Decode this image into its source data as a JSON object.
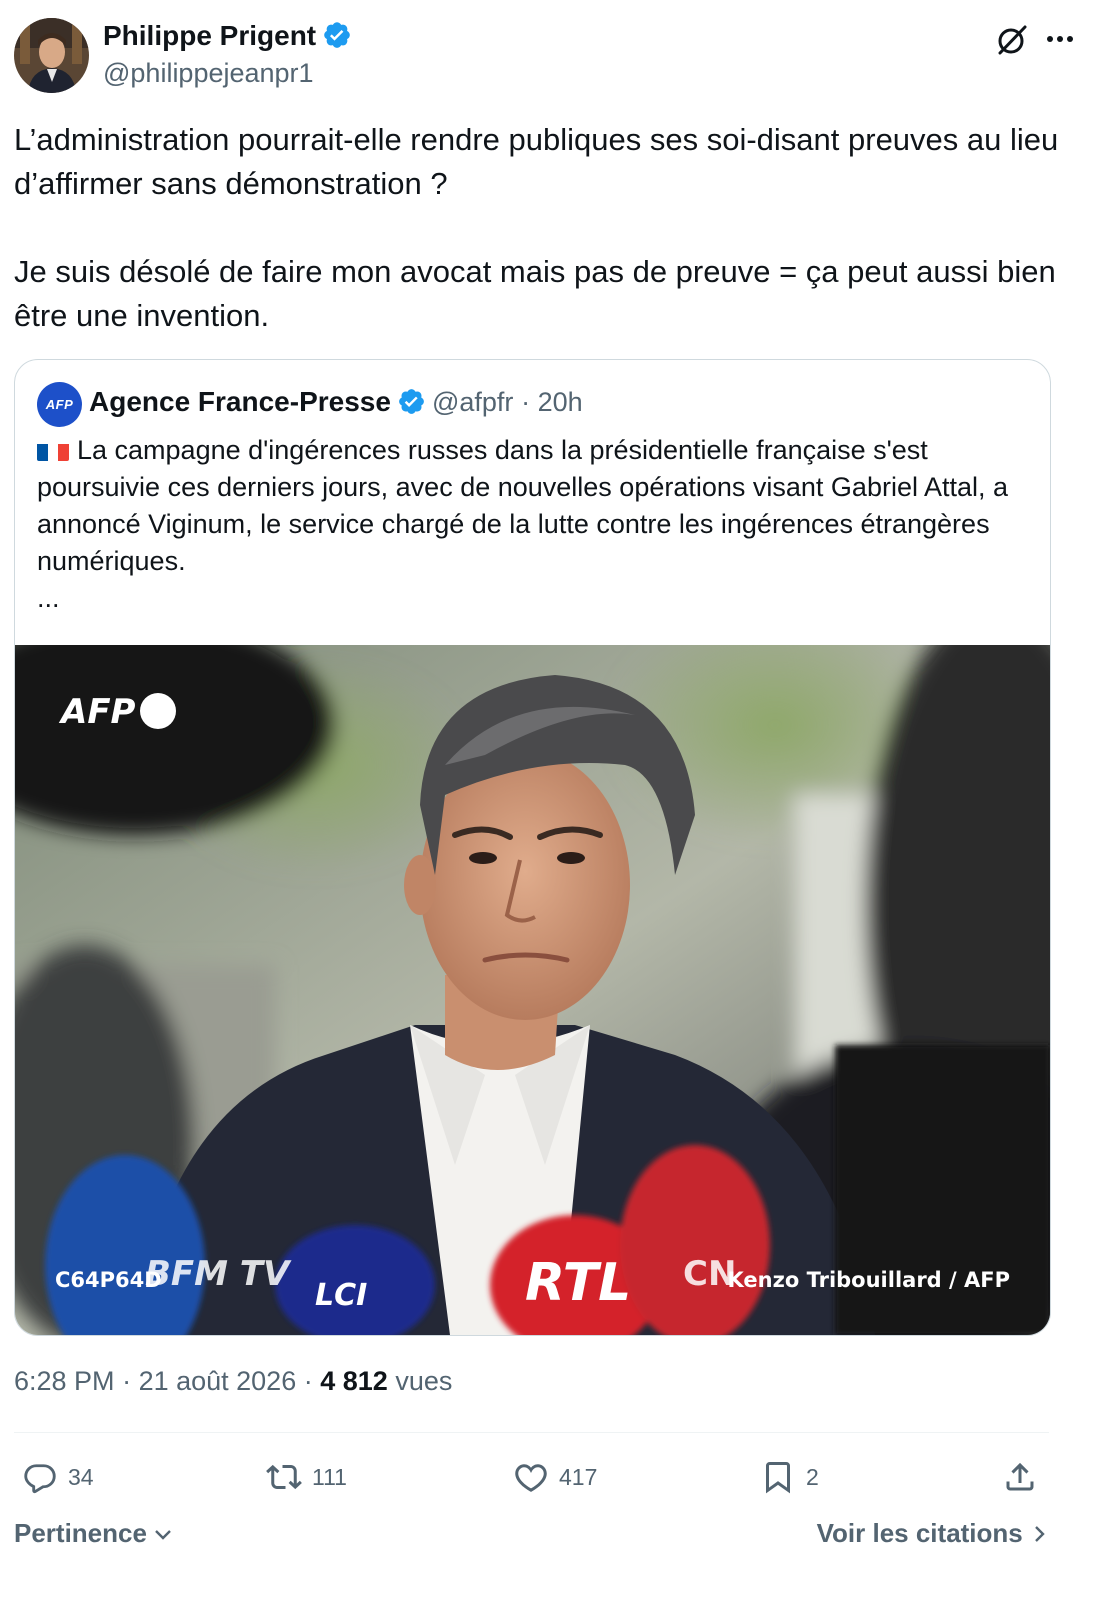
{
  "tweet": {
    "author_name": "Philippe Prigent",
    "author_handle": "@philippejeanpr1",
    "paragraphs": [
      "L’administration pourrait-elle rendre publiques ses soi-disant preuves au lieu d’affirmer sans démonstration ?",
      "Je suis désolé de faire mon avocat mais pas de preuve = ça peut aussi bien être une invention."
    ],
    "grok_icon": "grok-icon",
    "more_icon": "more-horizontal-icon"
  },
  "quote": {
    "avatar_label": "AFP",
    "author_name": "Agence France-Presse",
    "author_handle": "@afpfr",
    "time": "· 20h",
    "text": "La campagne d'ingérences russes dans la présidentielle française s'est poursuivie ces derniers jours, avec de nouvelles opérations visant Gabriel Attal, a annoncé Viginum, le service chargé de la lutte contre les ingérences étrangères numériques.",
    "ellipsis": "...",
    "photo": {
      "watermark": "AFP",
      "photo_id": "C64P64D",
      "credit": "Kenzo Tribouillard / AFP",
      "mic_labels": [
        "BFM TV",
        "LCI",
        "RTL",
        "CN"
      ]
    }
  },
  "meta": {
    "time": "6:28 PM",
    "date": "21 août 2026",
    "views_count": "4 812",
    "views_label": "vues"
  },
  "actions": {
    "replies": "34",
    "reposts": "111",
    "likes": "417",
    "bookmarks": "2"
  },
  "footer": {
    "sort_label": "Pertinence",
    "quotes_link": "Voir les citations"
  },
  "colors": {
    "text": "#0f1419",
    "secondary": "#536471",
    "verified": "#1d9bf0",
    "border": "#cfd9de"
  }
}
